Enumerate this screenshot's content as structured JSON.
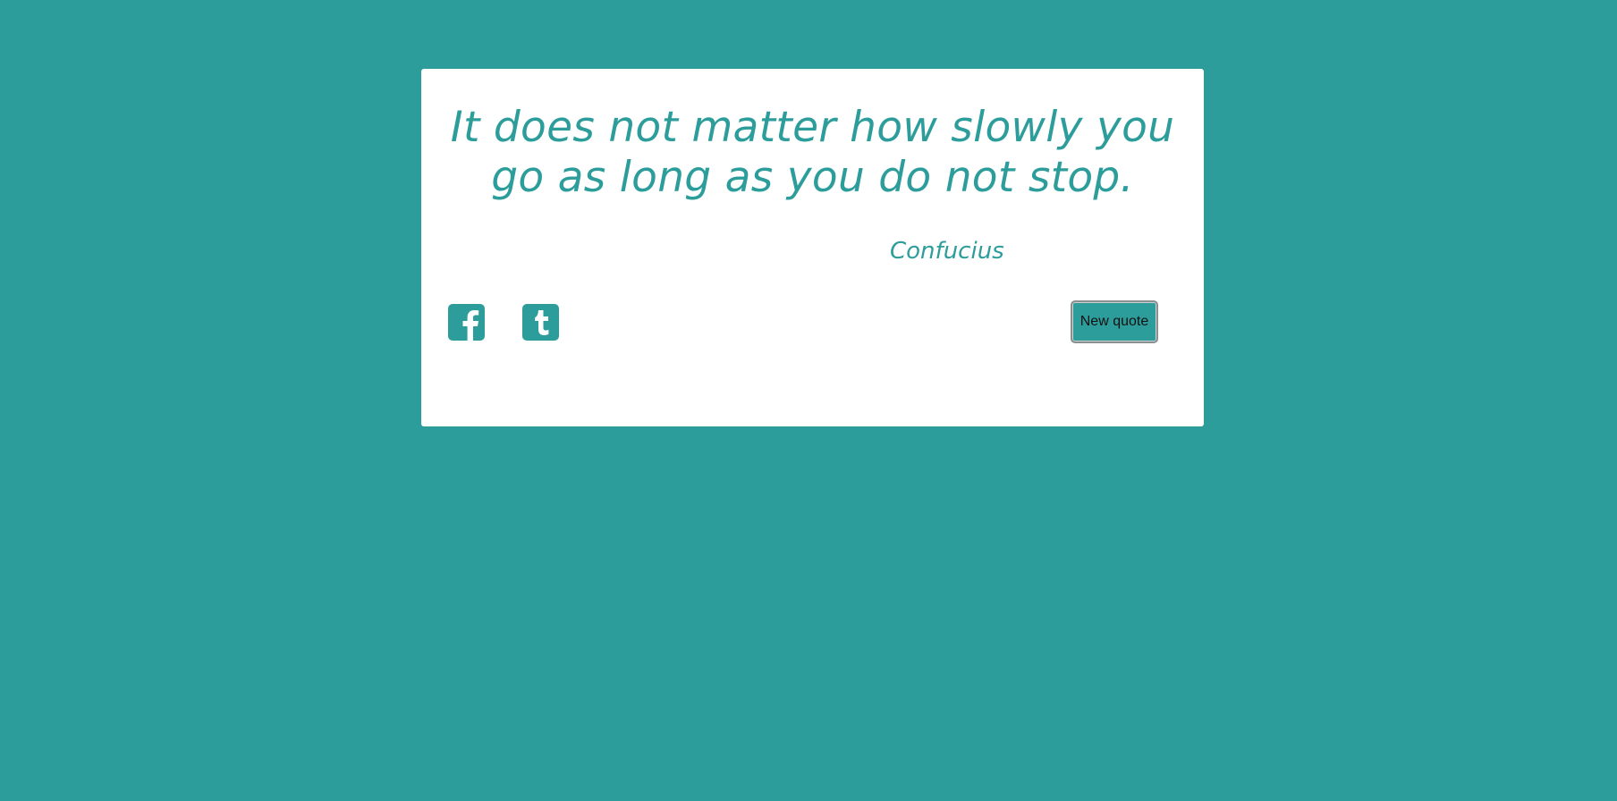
{
  "quote": {
    "text": "It does not matter how slowly you go as long as you do not stop.",
    "author": "Confucius"
  },
  "share": {
    "facebook_icon": "facebook-icon",
    "tumblr_icon": "tumblr-icon"
  },
  "actions": {
    "new_quote_label": "New quote"
  },
  "colors": {
    "accent": "#2d9d9b",
    "card": "#ffffff"
  }
}
